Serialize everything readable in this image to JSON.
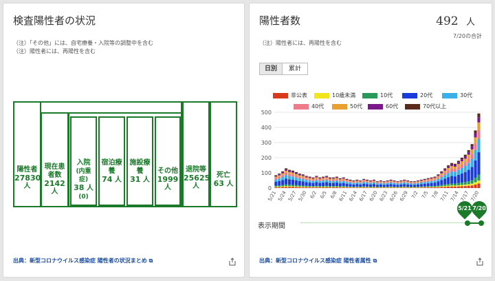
{
  "left": {
    "title": "検査陽性者の状況",
    "notes": [
      "（注）「その他」には、自宅療養・入院等の調整中を含む",
      "（注）陽性者には、再陽性を含む"
    ],
    "boxes": {
      "positive": {
        "label": "陽性者",
        "value": "27830",
        "unit": "人"
      },
      "current": {
        "label": "現在患者数",
        "value": "2142",
        "unit": "人"
      },
      "hospital": {
        "label": "入院",
        "sub_label": "(内重症)",
        "value": "38",
        "unit": "人",
        "sub_value": "(0)"
      },
      "hotel": {
        "label": "宿泊療養",
        "value": "74",
        "unit": "人"
      },
      "facility": {
        "label": "施設療養",
        "value": "31",
        "unit": "人"
      },
      "other": {
        "label": "その他",
        "value": "1999",
        "unit": "人"
      },
      "discharged": {
        "label": "退院等",
        "value": "25625",
        "unit": "人"
      },
      "deaths": {
        "label": "死亡",
        "value": "63",
        "unit": "人"
      }
    },
    "source": "出典：新型コロナウイルス感染症 陽性者の状況まとめ",
    "brand_color": "#1a7a2a",
    "link_color": "#1a4b9c"
  },
  "right": {
    "title": "陽性者数",
    "total_value": "492",
    "total_unit": "人",
    "total_date": "7/20の合計",
    "note": "（注）陽性者には、再陽性を含む",
    "tabs": [
      {
        "label": "日別",
        "active": true
      },
      {
        "label": "累計",
        "active": false
      }
    ],
    "range_label": "表示期間",
    "range_start": "5/21",
    "range_end": "7/20",
    "source": "出典：新型コロナウイルス感染症 陽性者属性"
  },
  "chart_data": {
    "type": "bar",
    "stacked": true,
    "ylim": [
      0,
      500
    ],
    "yticks": [
      0,
      100,
      200,
      300,
      400,
      500
    ],
    "x_tick_labels": [
      "5/21",
      "5/24",
      "5/27",
      "5/30",
      "6/2",
      "6/5",
      "6/8",
      "6/11",
      "6/14",
      "6/17",
      "6/20",
      "6/23",
      "6/26",
      "6/29",
      "7/2",
      "7/5",
      "7/8",
      "7/11",
      "7/14",
      "7/17",
      "7/20"
    ],
    "legend": [
      {
        "name": "非公表",
        "color": "#d93a1a"
      },
      {
        "name": "10歳未満",
        "color": "#f2e51a"
      },
      {
        "name": "10代",
        "color": "#2a9a5a"
      },
      {
        "name": "20代",
        "color": "#1a3ad9"
      },
      {
        "name": "30代",
        "color": "#3ab0e8"
      },
      {
        "name": "40代",
        "color": "#ee7a8a"
      },
      {
        "name": "50代",
        "color": "#e8a030"
      },
      {
        "name": "60代",
        "color": "#7a1a8a"
      },
      {
        "name": "70代以上",
        "color": "#5a2a1a"
      }
    ],
    "daily_totals": [
      85,
      95,
      110,
      130,
      120,
      115,
      105,
      95,
      90,
      80,
      75,
      70,
      80,
      70,
      75,
      80,
      70,
      70,
      75,
      65,
      70,
      60,
      55,
      50,
      55,
      50,
      60,
      55,
      50,
      55,
      45,
      50,
      45,
      50,
      55,
      50,
      45,
      50,
      55,
      50,
      45,
      45,
      50,
      55,
      60,
      65,
      70,
      75,
      90,
      110,
      130,
      150,
      165,
      160,
      180,
      200,
      220,
      250,
      290,
      380,
      492
    ],
    "mix": [
      0.06,
      0.04,
      0.08,
      0.3,
      0.18,
      0.12,
      0.1,
      0.07,
      0.05
    ]
  }
}
